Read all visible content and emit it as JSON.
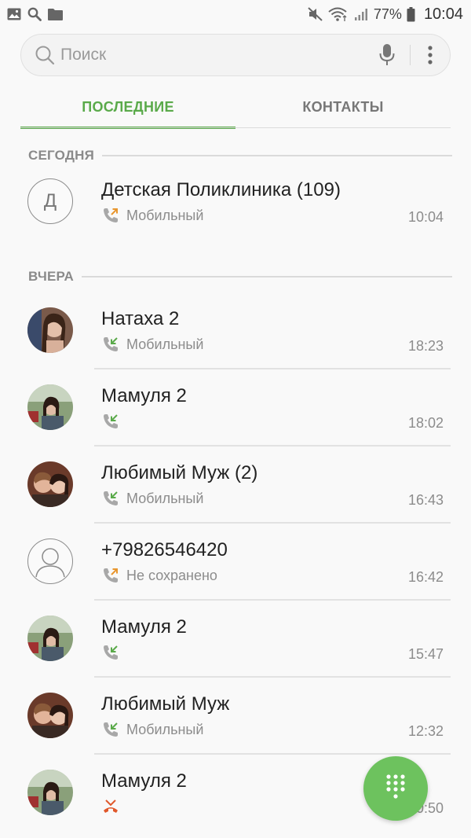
{
  "status_bar": {
    "battery": "77%",
    "time": "10:04"
  },
  "search": {
    "placeholder": "Поиск"
  },
  "tabs": [
    {
      "label": "ПОСЛЕДНИЕ",
      "active": true
    },
    {
      "label": "КОНТАКТЫ",
      "active": false
    }
  ],
  "sections": {
    "today": "СЕГОДНЯ",
    "yesterday": "ВЧЕРА"
  },
  "calls": [
    {
      "name": "Детская Поликлиника (109)",
      "avatar": "letter",
      "avatar_letter": "Д",
      "call_type": "outgoing",
      "number_type": "Мобильный",
      "time": "10:04"
    },
    {
      "name": "Натаха 2",
      "avatar": "photo",
      "call_type": "incoming",
      "number_type": "Мобильный",
      "time": "18:23"
    },
    {
      "name": "Мамуля 2",
      "avatar": "photo",
      "call_type": "incoming",
      "number_type": "",
      "time": "18:02"
    },
    {
      "name": "Любимый Муж (2)",
      "avatar": "photo",
      "call_type": "incoming",
      "number_type": "Мобильный",
      "time": "16:43"
    },
    {
      "name": "+79826546420",
      "avatar": "unknown",
      "call_type": "outgoing",
      "number_type": "Не сохранено",
      "time": "16:42"
    },
    {
      "name": "Мамуля 2",
      "avatar": "photo",
      "call_type": "incoming",
      "number_type": "",
      "time": "15:47"
    },
    {
      "name": "Любимый Муж",
      "avatar": "photo",
      "call_type": "incoming",
      "number_type": "Мобильный",
      "time": "12:32"
    },
    {
      "name": "Мамуля 2",
      "avatar": "photo",
      "call_type": "missed",
      "number_type": "",
      "time": "10:50"
    }
  ],
  "colors": {
    "accent": "#5aaa4a",
    "fab": "#6dc25e",
    "outgoing_arrow": "#e8962e",
    "incoming_arrow": "#5aaa4a",
    "missed": "#e0582b"
  },
  "icons": {
    "status_left": [
      "gallery-icon",
      "search-icon",
      "folder-icon"
    ],
    "status_right": [
      "mute-icon",
      "wifi-icon",
      "signal-icon",
      "battery-icon"
    ],
    "fab": "dialpad-icon"
  }
}
